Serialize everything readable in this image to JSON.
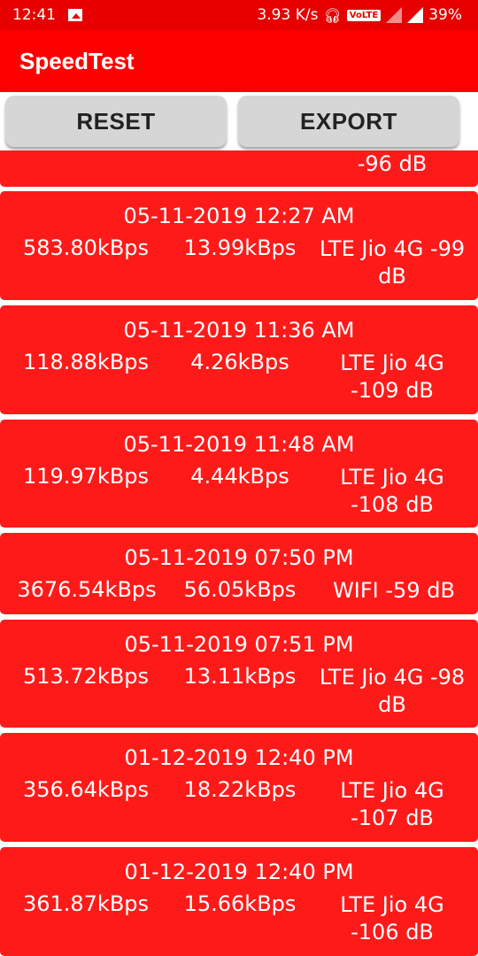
{
  "status_bar": {
    "time": "12:41",
    "speed": "3.93 K/s",
    "volte": "VoLTE",
    "battery": "39%"
  },
  "app_bar": {
    "title": "SpeedTest"
  },
  "toolbar": {
    "reset_label": "RESET",
    "export_label": "EXPORT"
  },
  "partial_card": {
    "network": "-96 dB"
  },
  "records": [
    {
      "date": "05-11-2019 12:27 AM",
      "download": "583.80kBps",
      "upload": "13.99kBps",
      "network": "LTE Jio 4G -99 dB"
    },
    {
      "date": "05-11-2019 11:36 AM",
      "download": "118.88kBps",
      "upload": "4.26kBps",
      "network": "LTE Jio 4G -109 dB"
    },
    {
      "date": "05-11-2019 11:48 AM",
      "download": "119.97kBps",
      "upload": "4.44kBps",
      "network": "LTE Jio 4G -108 dB"
    },
    {
      "date": "05-11-2019 07:50 PM",
      "download": "3676.54kBps",
      "upload": "56.05kBps",
      "network": "WIFI -59 dB"
    },
    {
      "date": "05-11-2019 07:51 PM",
      "download": "513.72kBps",
      "upload": "13.11kBps",
      "network": "LTE Jio 4G -98 dB"
    },
    {
      "date": "01-12-2019 12:40 PM",
      "download": "356.64kBps",
      "upload": "18.22kBps",
      "network": "LTE Jio 4G -107 dB"
    },
    {
      "date": "01-12-2019 12:40 PM",
      "download": "361.87kBps",
      "upload": "15.66kBps",
      "network": "LTE Jio 4G -106 dB"
    }
  ],
  "colors": {
    "status_bar": "#e60000",
    "app_bar": "#ff0000",
    "card": "#ff1a1a",
    "button": "#d6d6d6"
  }
}
